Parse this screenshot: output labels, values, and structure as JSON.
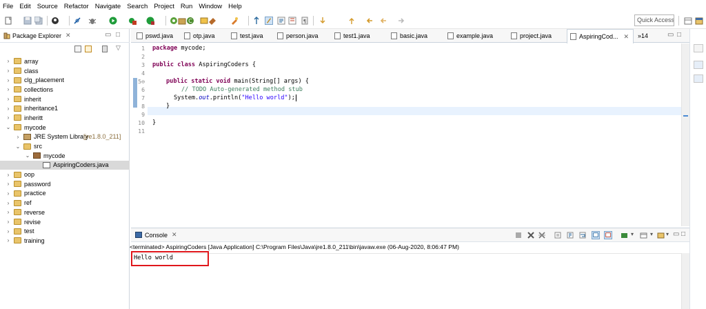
{
  "menu": [
    "File",
    "Edit",
    "Source",
    "Refactor",
    "Navigate",
    "Search",
    "Project",
    "Run",
    "Window",
    "Help"
  ],
  "toolbar": {
    "quick_access_placeholder": "Quick Access",
    "icons": [
      "new-icon",
      "save-icon",
      "save-all-icon",
      "profile-icon",
      "skip-breakpoints-icon",
      "debug-icon",
      "run-icon",
      "coverage-icon",
      "external-tools-icon",
      "new-java-project-icon",
      "new-package-icon",
      "new-class-icon",
      "open-type-icon",
      "search-icon",
      "toggle-mark-occurrences-icon",
      "toggle-word-wrap-icon",
      "show-whitespace-icon",
      "next-annotation-icon",
      "previous-annotation-icon",
      "last-edit-location-icon",
      "back-icon",
      "forward-icon",
      "perspective-icon"
    ]
  },
  "package_explorer": {
    "title": "Package Explorer",
    "close_glyph": "✕",
    "items": [
      {
        "label": "array",
        "level": 0,
        "type": "project",
        "expanded": false
      },
      {
        "label": "class",
        "level": 0,
        "type": "project",
        "expanded": false
      },
      {
        "label": "clg_placement",
        "level": 0,
        "type": "project",
        "expanded": false
      },
      {
        "label": "collections",
        "level": 0,
        "type": "project",
        "expanded": false
      },
      {
        "label": "inherit",
        "level": 0,
        "type": "project",
        "expanded": false
      },
      {
        "label": "inheritance1",
        "level": 0,
        "type": "project",
        "expanded": false
      },
      {
        "label": "inheritt",
        "level": 0,
        "type": "project",
        "expanded": false
      },
      {
        "label": "mycode",
        "level": 0,
        "type": "project",
        "expanded": true
      },
      {
        "label": "JRE System Library",
        "decoration": "[jre1.8.0_211]",
        "level": 1,
        "type": "library",
        "expanded": false
      },
      {
        "label": "src",
        "level": 1,
        "type": "folder",
        "expanded": true
      },
      {
        "label": "mycode",
        "level": 2,
        "type": "package",
        "expanded": true
      },
      {
        "label": "AspiringCoders.java",
        "level": 3,
        "type": "java",
        "expanded": false,
        "selected": true
      },
      {
        "label": "oop",
        "level": 0,
        "type": "project",
        "expanded": false
      },
      {
        "label": "password",
        "level": 0,
        "type": "project",
        "expanded": false
      },
      {
        "label": "practice",
        "level": 0,
        "type": "project",
        "expanded": false
      },
      {
        "label": "ref",
        "level": 0,
        "type": "project",
        "expanded": false
      },
      {
        "label": "reverse",
        "level": 0,
        "type": "project",
        "expanded": false
      },
      {
        "label": "revise",
        "level": 0,
        "type": "project",
        "expanded": false
      },
      {
        "label": "test",
        "level": 0,
        "type": "project",
        "expanded": false
      },
      {
        "label": "training",
        "level": 0,
        "type": "project",
        "expanded": false
      }
    ]
  },
  "editor": {
    "tabs": [
      "pswd.java",
      "otp.java",
      "test.java",
      "person.java",
      "test1.java",
      "basic.java",
      "example.java",
      "project.java",
      "AspiringCod..."
    ],
    "active_tab": "AspiringCod...",
    "overflow_label": "»14",
    "line_numbers": [
      "1",
      "2",
      "3",
      "4",
      "5⊖",
      "6",
      "7",
      "8",
      "9",
      "10",
      "11"
    ],
    "code": {
      "l1_kw": "package",
      "l1_rest": " mycode;",
      "l3_kw": "public class",
      "l3_rest": " AspiringCoders {",
      "l5_kw": "public static void",
      "l5_rest": " main(String[] args) {",
      "l6_comment": "// TODO Auto-generated method stub",
      "l7_pre": "System.",
      "l7_field": "out",
      "l7_mid": ".println(",
      "l7_str": "\"Hello world\"",
      "l7_end": ");",
      "l8": "}",
      "l10": "}"
    }
  },
  "console": {
    "title": "Console",
    "close_glyph": "✕",
    "status": "<terminated> AspiringCoders [Java Application] C:\\Program Files\\Java\\jre1.8.0_211\\bin\\javaw.exe (06-Aug-2020, 8:06:47 PM)",
    "output": "Hello world",
    "highlight_color": "#e0161b"
  }
}
